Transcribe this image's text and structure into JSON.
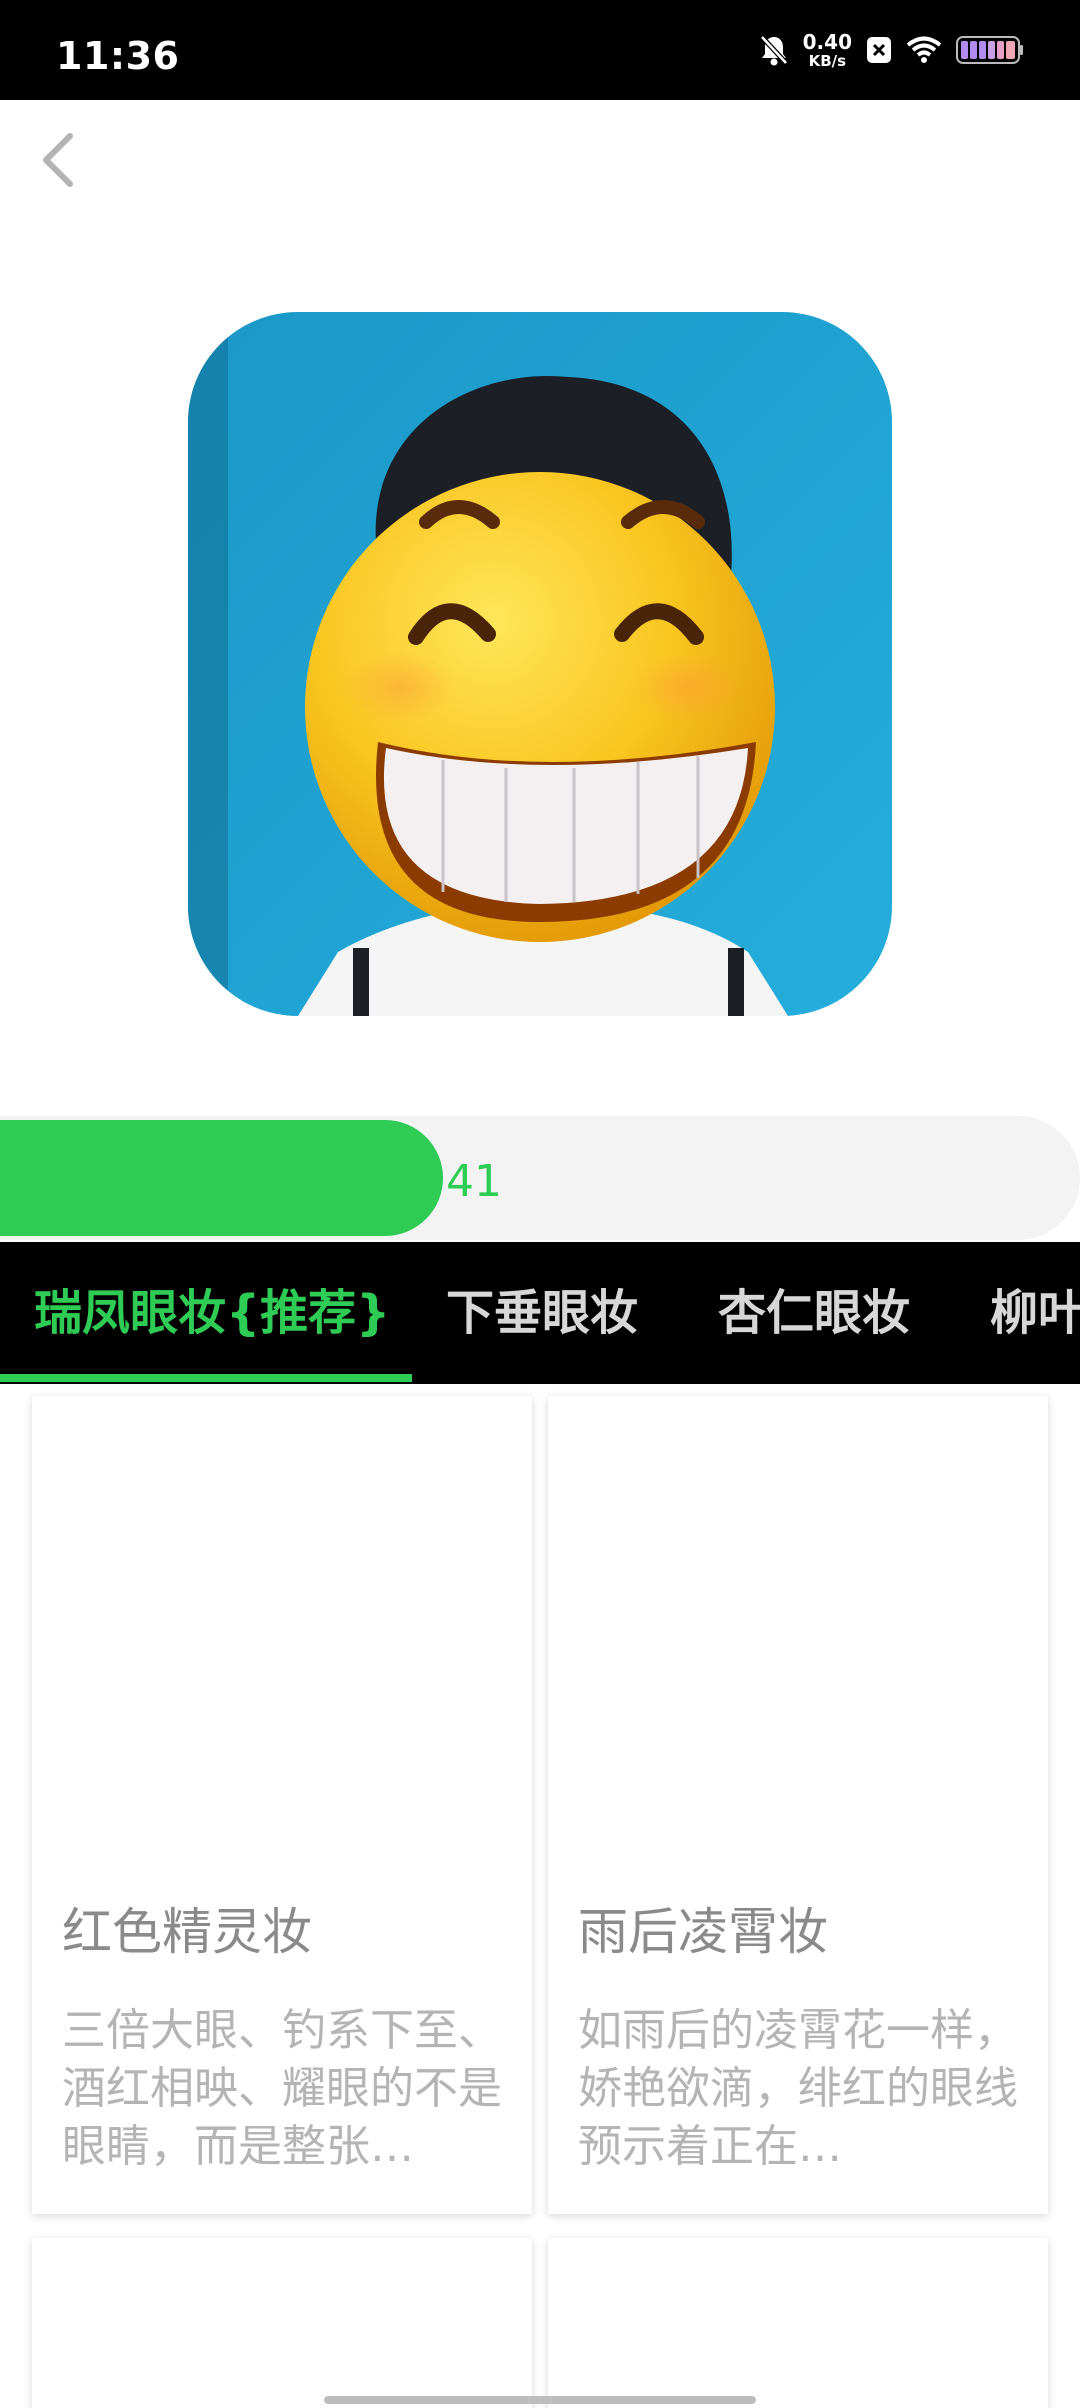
{
  "status_bar": {
    "time": "11:36",
    "net_speed_value": "0.40",
    "net_speed_unit": "KB/s",
    "icons": [
      "bell-muted-icon",
      "close-box-icon",
      "wifi-icon",
      "battery-icon"
    ]
  },
  "hero": {
    "image": "portrait-with-grinning-emoji-face"
  },
  "progress": {
    "value": "41",
    "fraction": 0.41,
    "color": "#2ecc55"
  },
  "tabs": [
    {
      "label": "瑞凤眼妆{推荐}",
      "active": true
    },
    {
      "label": "下垂眼妆",
      "active": false
    },
    {
      "label": "杏仁眼妆",
      "active": false
    },
    {
      "label": "柳叶",
      "active": false
    }
  ],
  "cards": [
    {
      "title": "红色精灵妆",
      "desc": "三倍大眼、钓系下至、酒红相映、耀眼的不是眼睛，而是整张…"
    },
    {
      "title": "雨后凌霄妆",
      "desc": "如雨后的凌霄花一样，娇艳欲滴，绯红的眼线预示着正在…"
    },
    {
      "title": "",
      "desc": ""
    },
    {
      "title": "",
      "desc": ""
    }
  ],
  "colors": {
    "accent": "#2ecc55",
    "tab_bar_bg": "#000000",
    "status_bar_bg": "#000000"
  }
}
